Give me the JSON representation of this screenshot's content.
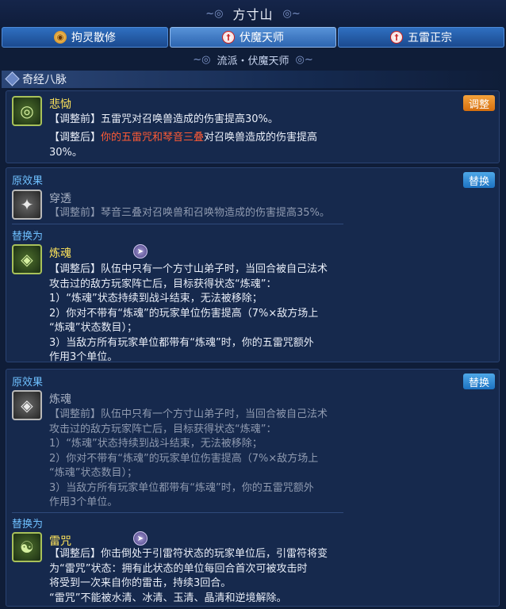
{
  "header": {
    "title": "方寸山"
  },
  "tabs": [
    {
      "label": "拘灵散修",
      "icon": "coin-icon",
      "active": false
    },
    {
      "label": "伏魔天师",
      "icon": "fangcun-emblem-icon",
      "active": true
    },
    {
      "label": "五雷正宗",
      "icon": "fangcun-emblem-icon",
      "active": false
    }
  ],
  "school_line": "流派・伏魔天师",
  "section_title": "奇经八脉",
  "card1": {
    "name": "悲恸",
    "badge": "调整",
    "before": "【调整前】五雷咒对召唤兽造成的伤害提高30%。",
    "after_prefix": "【调整后】",
    "after_red": "你的五雷咒和琴音三叠",
    "after_rest_line1": "对召唤兽造成的伤害提高",
    "after_rest_line2": "30%。"
  },
  "card2": {
    "original_label": "原效果",
    "badge": "替换",
    "orig_name": "穿透",
    "orig_text": "【调整前】琴音三叠对召唤兽和召唤物造成的伤害提高35%。",
    "replace_label": "替换为",
    "new_name": "炼魂",
    "new_lines": [
      "【调整后】队伍中只有一个方寸山弟子时，当回合被自己法术",
      "攻击过的敌方玩家阵亡后，目标获得状态“炼魂”：",
      "1）“炼魂”状态持续到战斗结束，无法被移除；",
      "2）你对不带有“炼魂”的玩家单位伤害提高（7%×敌方场上",
      "“炼魂”状态数目）；",
      "3）当敌方所有玩家单位都带有“炼魂”时，你的五雷咒额外",
      "作用3个单位。"
    ]
  },
  "card3": {
    "original_label": "原效果",
    "badge": "替换",
    "orig_name": "炼魂",
    "orig_lines": [
      "【调整前】队伍中只有一个方寸山弟子时，当回合被自己法术",
      "攻击过的敌方玩家阵亡后，目标获得状态“炼魂”：",
      "1）“炼魂”状态持续到战斗结束，无法被移除；",
      "2）你对不带有“炼魂”的玩家单位伤害提高（7%×敌方场上",
      "“炼魂”状态数目）；",
      "3）当敌方所有玩家单位都带有“炼魂”时，你的五雷咒额外",
      "作用3个单位。"
    ],
    "replace_label": "替换为",
    "new_name": "雷咒",
    "new_lines": [
      "【调整后】你击倒处于引雷符状态的玩家单位后，引雷符将变",
      "为“雷咒”状态：拥有此状态的单位每回合首次可被攻击时",
      "将受到一次来自你的雷击，持续3回合。",
      "“雷咒”不能被水清、冰清、玉清、晶清和逆境解除。"
    ]
  },
  "colors": {
    "background": "#0f1d38",
    "gold": "#ffe45a",
    "red": "#ff5a35",
    "blue_label": "#6fc0ff",
    "badge_orange": "#e2841f",
    "badge_blue": "#2f8ad6"
  }
}
